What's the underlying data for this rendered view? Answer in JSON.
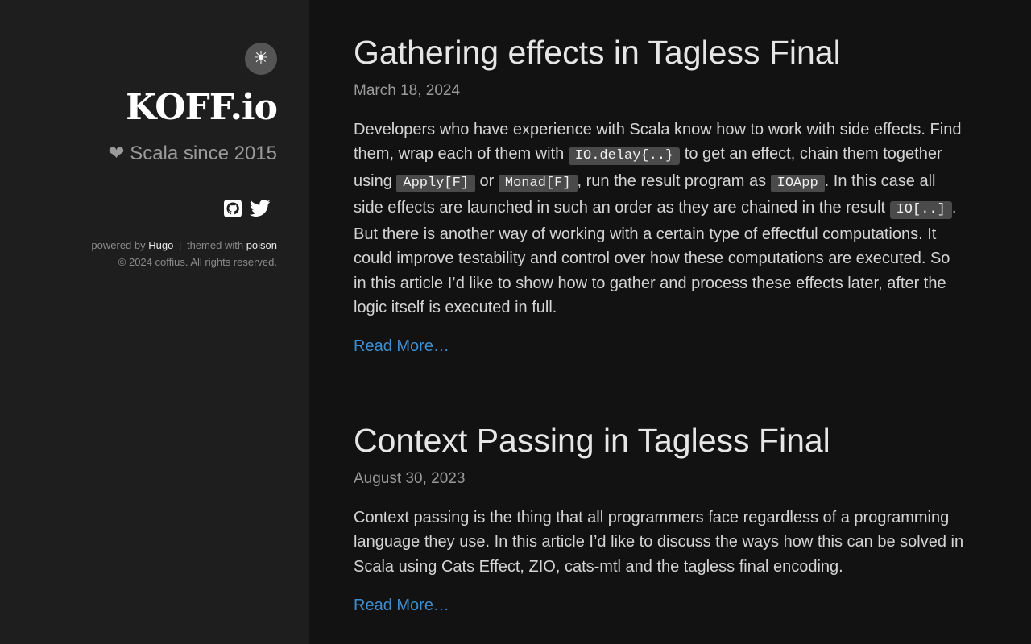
{
  "sidebar": {
    "theme_toggle_icon": "☀",
    "site_title": "KOFF.io",
    "tagline": "❤ Scala since 2015",
    "social": [
      {
        "icon": "github-icon"
      },
      {
        "icon": "twitter-icon"
      }
    ],
    "footer": {
      "powered_by": "powered by",
      "hugo": "Hugo",
      "separator": "|",
      "themed_with": "themed with",
      "poison": "poison",
      "copyright": "© 2024 coffius. All rights reserved."
    }
  },
  "posts": [
    {
      "title": "Gathering effects in Tagless Final",
      "date": "March 18, 2024",
      "summary": {
        "t1": "Developers who have experience with Scala know how to work with side effects. Find them, wrap each of them with ",
        "c1": "IO.delay{..}",
        "t2": " to get an effect, chain them together using ",
        "c2": "Apply[F]",
        "t3": " or ",
        "c3": "Monad[F]",
        "t4": ", run the result program as ",
        "c4": "IOApp",
        "t5": ". In this case all side effects are launched in such an order as they are chained in the result ",
        "c5": "IO[..]",
        "t6": ". But there is another way of working with a certain type of effectful computations. It could improve testability and control over how these computations are executed. So in this article I’d like to show how to gather and process these effects later, after the logic itself is executed in full."
      },
      "read_more": "Read More…"
    },
    {
      "title": "Context Passing in Tagless Final",
      "date": "August 30, 2023",
      "summary": "Context passing is the thing that all programmers face regardless of a programming language they use. In this article I’d like to discuss the ways how this can be solved in Scala using Cats Effect, ZIO, cats-mtl and the tagless final encoding.",
      "read_more": "Read More…"
    }
  ],
  "colors": {
    "background": "#121212",
    "sidebar": "#1e1e1e",
    "link": "#3d8ed0",
    "code_bg": "#4a4a4a"
  }
}
